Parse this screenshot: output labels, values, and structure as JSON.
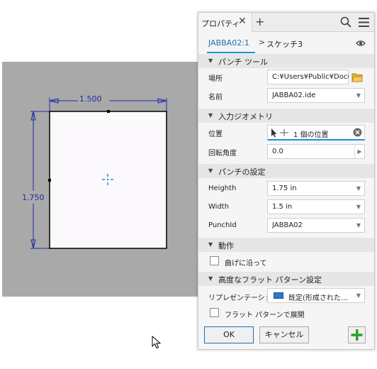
{
  "panel": {
    "tab_label": "プロパティ",
    "breadcrumb": {
      "link": "JABBA02:1",
      "separator": ">",
      "current": "スケッチ3"
    },
    "sections": {
      "punch_tool": "パンチ ツール",
      "geometry": "入力ジオメトリ",
      "punch_settings": "パンチの設定",
      "behavior": "動作",
      "advanced": "高度なフラット パターン設定"
    },
    "fields": {
      "location_label": "場所",
      "location_value": "C:¥Users¥Public¥Docum",
      "name_label": "名前",
      "name_value": "JABBA02.ide",
      "position_label": "位置",
      "position_value": "1 個の位置",
      "rotation_label": "回転角度",
      "rotation_value": "0.0",
      "height_label": "Heighth",
      "height_value": "1.75 in",
      "width_label": "Width",
      "width_value": "1.5 in",
      "punchid_label": "PunchId",
      "punchid_value": "JABBA02",
      "follow_bend_label": "曲げに沿って",
      "representation_label": "リプレゼンテーション",
      "representation_value": "既定(形成された…",
      "unfold_label": "フラット パターンで展開"
    },
    "buttons": {
      "ok": "OK",
      "cancel": "キャンセル"
    }
  },
  "sketch": {
    "dim_width": "1.500",
    "dim_height": "1.750"
  },
  "colors": {
    "accent": "#1a8fd8",
    "link": "#1a6fb5",
    "dimension": "#1f2aa8",
    "canvas": "#a9a9a9",
    "plus_green": "#2ca02c",
    "folder": "#e8b33a"
  }
}
